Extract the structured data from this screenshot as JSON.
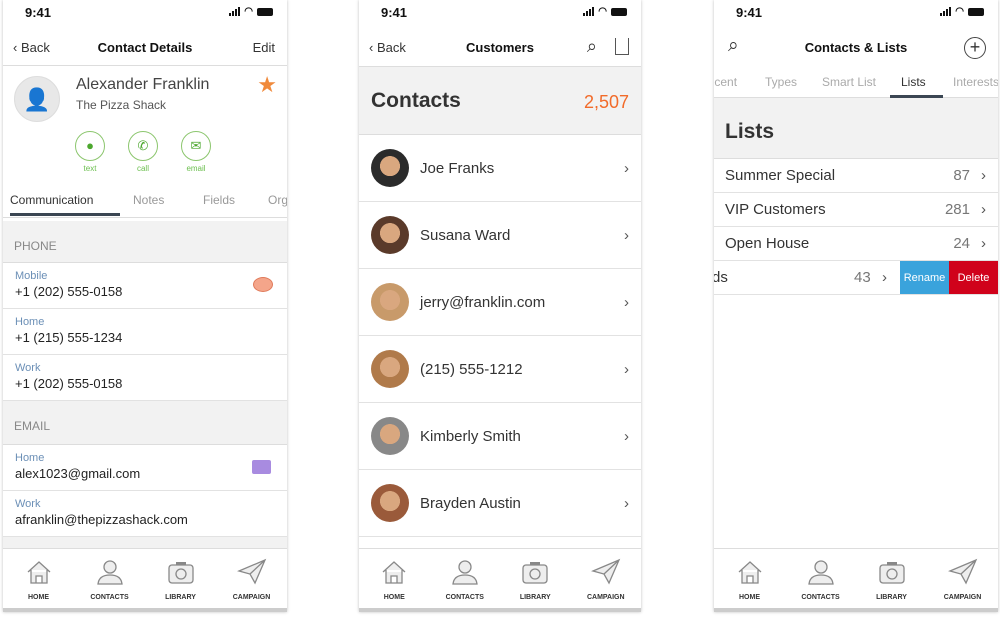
{
  "status_time": "9:41",
  "screen1": {
    "back": "Back",
    "title": "Contact Details",
    "edit": "Edit",
    "name": "Alexander Franklin",
    "company": "The Pizza Shack",
    "favorite_color": "#f08a3c",
    "actions": [
      {
        "label": "text",
        "icon": "chat-bubble-icon"
      },
      {
        "label": "call",
        "icon": "phone-icon"
      },
      {
        "label": "email",
        "icon": "envelope-icon"
      }
    ],
    "tabs": [
      "Communication",
      "Notes",
      "Fields",
      "Org"
    ],
    "active_tab": "Communication",
    "phone_header": "PHONE",
    "phones": [
      {
        "label": "Mobile",
        "value": "+1 (202) 555-0158"
      },
      {
        "label": "Home",
        "value": "+1 (215) 555-1234"
      },
      {
        "label": "Work",
        "value": "+1 (202) 555-0158"
      }
    ],
    "email_header": "EMAIL",
    "emails": [
      {
        "label": "Home",
        "value": "alex1023@gmail.com"
      },
      {
        "label": "Work",
        "value": "afranklin@thepizzashack.com"
      }
    ]
  },
  "screen2": {
    "back": "Back",
    "title": "Customers",
    "heading": "Contacts",
    "count": "2,507",
    "count_color": "#f26b2a",
    "contacts": [
      "Joe Franks",
      "Susana Ward",
      "jerry@franklin.com",
      "(215) 555-1212",
      "Kimberly Smith",
      "Brayden Austin"
    ]
  },
  "screen3": {
    "title": "Contacts & Lists",
    "tabs": [
      "Recent",
      "Types",
      "Smart List",
      "Lists",
      "Interests"
    ],
    "active_tab": "Lists",
    "heading": "Lists",
    "lists": [
      {
        "name": "Summer Special",
        "count": "87"
      },
      {
        "name": "VIP Customers",
        "count": "281"
      },
      {
        "name": "Open House",
        "count": "24"
      },
      {
        "name": "Leads",
        "count": "43"
      }
    ],
    "rename": "Rename",
    "delete": "Delete",
    "rename_color": "#3aa3dc",
    "delete_color": "#d0021b"
  },
  "tabbar": [
    "HOME",
    "CONTACTS",
    "LIBRARY",
    "CAMPAIGN"
  ]
}
